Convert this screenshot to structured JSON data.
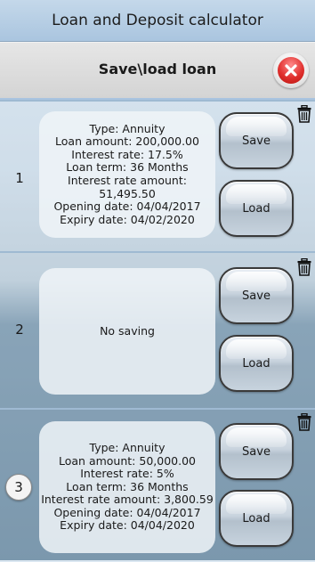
{
  "app": {
    "title": "Loan and Deposit calculator"
  },
  "dialog": {
    "title": "Save\\load loan",
    "close_icon": "close-icon"
  },
  "slots": [
    {
      "number": "1",
      "lines": [
        "Type: Annuity",
        "Loan amount: 200,000.00",
        "Interest rate: 17.5%",
        "Loan term: 36 Months",
        "Interest rate amount: 51,495.50",
        "Opening date: 04/04/2017",
        "Expiry date: 04/02/2020"
      ],
      "save_label": "Save",
      "load_label": "Load"
    },
    {
      "number": "2",
      "lines": [
        "No saving"
      ],
      "save_label": "Save",
      "load_label": "Load"
    },
    {
      "number": "3",
      "lines": [
        "Type: Annuity",
        "Loan amount: 50,000.00",
        "Interest rate: 5%",
        "Loan term: 36 Months",
        "Interest rate amount: 3,800.59",
        "Opening date: 04/04/2017",
        "Expiry date: 04/04/2020"
      ],
      "save_label": "Save",
      "load_label": "Load"
    }
  ],
  "colors": {
    "header_blue": "#aac5df",
    "close_red": "#e0302e"
  }
}
